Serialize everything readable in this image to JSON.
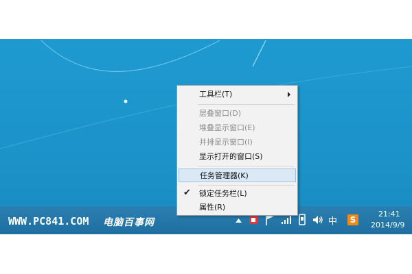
{
  "context_menu": {
    "items": [
      {
        "label": "工具栏(T)"
      },
      {
        "label": "层叠窗口(D)"
      },
      {
        "label": "堆叠显示窗口(E)"
      },
      {
        "label": "并排显示窗口(I)"
      },
      {
        "label": "显示打开的窗口(S)"
      },
      {
        "label": "任务管理器(K)"
      },
      {
        "label": "锁定任务栏(L)",
        "checked": true
      },
      {
        "label": "属性(R)"
      }
    ]
  },
  "watermark": {
    "site": "WWW.PC841.COM",
    "brand": "电脑百事网"
  },
  "tray": {
    "ime": "中",
    "sogou": "S",
    "icons": [
      "show-hidden-icon",
      "app-tray-icon",
      "flag-icon",
      "network-signal-icon",
      "device-icon",
      "volume-icon"
    ]
  },
  "clock": {
    "time": "21:41",
    "date": "2014/9/9"
  },
  "colors": {
    "desktop": "#1f9ad0",
    "taskbar": "#2275a7",
    "menu_background": "#f2f2f2",
    "menu_highlight": "#dbe8f5",
    "sogou": "#f08a17"
  }
}
